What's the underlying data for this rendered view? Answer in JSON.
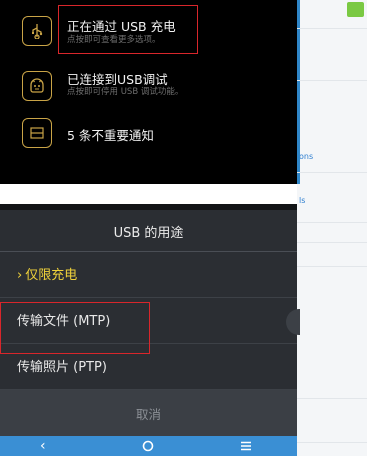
{
  "notifications": [
    {
      "title": "正在通过 USB 充电",
      "subtitle": "点按即可查看更多选项。",
      "icon": "usb-icon"
    },
    {
      "title": "已连接到USB调试",
      "subtitle": "点按即可停用 USB 调试功能。",
      "icon": "android-debug-icon"
    },
    {
      "title": "5 条不重要通知",
      "subtitle": "",
      "icon": "notification-stack-icon"
    }
  ],
  "background_app": {
    "link_text_1": "ons",
    "link_text_2": "ls"
  },
  "usb_dialog": {
    "title": "USB 的用途",
    "options": [
      {
        "label": "仅限充电",
        "selected": true
      },
      {
        "label": "传输文件 (MTP)",
        "selected": false
      },
      {
        "label": "传输照片 (PTP)",
        "selected": false
      }
    ],
    "cancel_label": "取消"
  },
  "navbar": {
    "back_icon": "back-icon",
    "home_icon": "home-icon",
    "menu_icon": "menu-icon"
  },
  "colors": {
    "highlight_red": "#d9262b",
    "selected_yellow": "#f0d23a",
    "navbar_blue": "#3a8fd4",
    "icon_gold": "#c9a447"
  }
}
